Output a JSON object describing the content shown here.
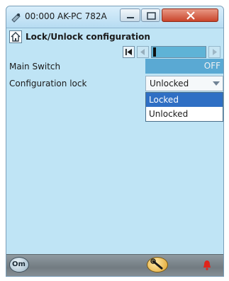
{
  "window": {
    "title": "00:000 AK-PC 782A"
  },
  "header": {
    "title": "Lock/Unlock configuration"
  },
  "rows": {
    "main_switch": {
      "label": "Main Switch",
      "value": "OFF"
    },
    "configuration_lock": {
      "label": "Configuration lock",
      "value": "Unlocked",
      "options": [
        "Locked",
        "Unlocked"
      ],
      "highlighted_option": "Locked"
    }
  },
  "footer": {
    "left_button_text": "Om"
  },
  "colors": {
    "window_bg": "#bfe4f5",
    "value_bg": "#5aa9d3",
    "selection": "#2f6fc4",
    "alarm": "#e0241a"
  },
  "icons": {
    "title": "remote-icon",
    "header": "home-icon",
    "pager_first": "skip-first-icon",
    "pager_prev": "previous-icon",
    "pager_next": "next-icon",
    "tool": "wrench-icon",
    "alarm": "bell-icon"
  }
}
